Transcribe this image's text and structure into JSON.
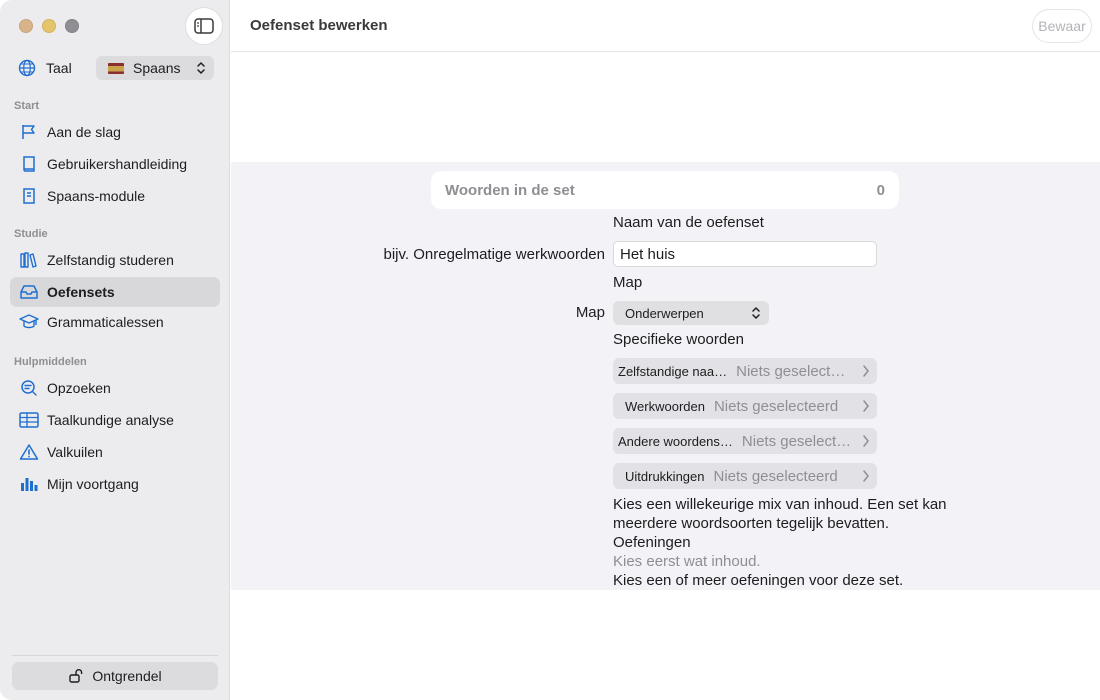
{
  "toolbar": {
    "title": "Oefenset bewerken",
    "save_label": "Bewaar"
  },
  "sidebar": {
    "language_label": "Taal",
    "language_value": "Spaans",
    "sections": {
      "start": "Start",
      "study": "Studie",
      "tools": "Hulpmiddelen"
    },
    "items": [
      {
        "label": "Aan de slag",
        "icon": "flag-icon"
      },
      {
        "label": "Gebruikershandleiding",
        "icon": "book-icon"
      },
      {
        "label": "Spaans-module",
        "icon": "module-book-icon"
      },
      {
        "label": "Zelfstandig studeren",
        "icon": "books-icon"
      },
      {
        "label": "Oefensets",
        "icon": "tray-icon",
        "active": true
      },
      {
        "label": "Grammaticalessen",
        "icon": "graduation-cap-icon"
      },
      {
        "label": "Opzoeken",
        "icon": "magnify-text-icon"
      },
      {
        "label": "Taalkundige analyse",
        "icon": "table-icon"
      },
      {
        "label": "Valkuilen",
        "icon": "warning-icon"
      },
      {
        "label": "Mijn voortgang",
        "icon": "bar-chart-icon"
      }
    ],
    "unlock_label": "Ontgrendel"
  },
  "form": {
    "words_in_set_label": "Woorden in de set",
    "words_in_set_count": "0",
    "name_section_label": "Naam van de oefenset",
    "name_placeholder_label": "bijv. Onregelmatige werkwoorden",
    "name_value": "Het huis",
    "folder_section_label": "Map",
    "folder_label": "Map",
    "folder_value": "Onderwerpen",
    "specific_words_label": "Specifieke woorden",
    "word_rows": [
      {
        "key": "Zelfstandige naa…",
        "value": "Niets geselect…"
      },
      {
        "key": "Werkwoorden",
        "value": "Niets geselecteerd"
      },
      {
        "key": "Andere woordens…",
        "value": "Niets geselect…"
      },
      {
        "key": "Uitdrukkingen",
        "value": "Niets geselecteerd"
      }
    ],
    "mix_help": "Kies een willekeurige mix van inhoud. Een set kan meerdere woordsoorten tegelijk bevatten.",
    "exercises_label": "Oefeningen",
    "exercises_empty": "Kies eerst wat inhoud.",
    "exercises_help": "Kies een of meer oefeningen voor deze set."
  },
  "colors": {
    "accent": "#1f6fd1",
    "sidebar_bg": "#ececee",
    "form_bg": "#f2f2f7"
  }
}
